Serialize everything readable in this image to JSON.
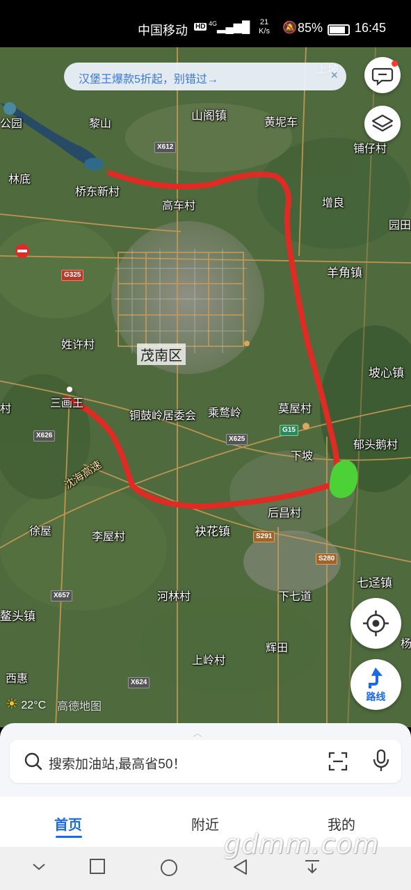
{
  "status_bar": {
    "carrier": "中国移动",
    "hd": "HD",
    "signal": "4G",
    "speed_value": "21",
    "speed_unit": "K/s",
    "battery": "85%",
    "time": "16:45"
  },
  "promo": {
    "text": "汉堡王爆款5折起，别错过→",
    "close": "×"
  },
  "map": {
    "district": "茂南区",
    "places": [
      {
        "name": "公园"
      },
      {
        "name": "黎山"
      },
      {
        "name": "山阁镇"
      },
      {
        "name": "黄坭车"
      },
      {
        "name": "铺仔村"
      },
      {
        "name": "林底"
      },
      {
        "name": "桥东新村"
      },
      {
        "name": "高车村"
      },
      {
        "name": "增良"
      },
      {
        "name": "园田"
      },
      {
        "name": "羊角镇"
      },
      {
        "name": "姓许村"
      },
      {
        "name": "坡心镇"
      },
      {
        "name": "三画王"
      },
      {
        "name": "铜鼓岭居委会"
      },
      {
        "name": "乘鹜岭"
      },
      {
        "name": "莫屋村"
      },
      {
        "name": "郁头鹅村"
      },
      {
        "name": "下坡"
      },
      {
        "name": "沈海高速"
      },
      {
        "name": "后昌村"
      },
      {
        "name": "徐屋"
      },
      {
        "name": "李屋村"
      },
      {
        "name": "袂花镇"
      },
      {
        "name": "七迳镇"
      },
      {
        "name": "河林村"
      },
      {
        "name": "下七道"
      },
      {
        "name": "鳌头镇"
      },
      {
        "name": "辉田"
      },
      {
        "name": "上岭村"
      },
      {
        "name": "西惠"
      },
      {
        "name": "杨"
      },
      {
        "name": "村"
      },
      {
        "name": "上坡"
      }
    ],
    "roads": [
      {
        "code": "X612"
      },
      {
        "code": "G325"
      },
      {
        "code": "G15"
      },
      {
        "code": "X626"
      },
      {
        "code": "X625"
      },
      {
        "code": "S291"
      },
      {
        "code": "S280"
      },
      {
        "code": "X657"
      },
      {
        "code": "X624"
      }
    ],
    "route_color": "#e02a24",
    "destination_color": "#4cd137"
  },
  "weather": {
    "temp": "22°C"
  },
  "brand": "高德地图",
  "route_button": {
    "label": "路线"
  },
  "search": {
    "placeholder": "搜索加油站,最高省50！"
  },
  "tabs": [
    {
      "label": "首页"
    },
    {
      "label": "附近"
    },
    {
      "label": "我的"
    }
  ],
  "watermark": "gdmm.com"
}
